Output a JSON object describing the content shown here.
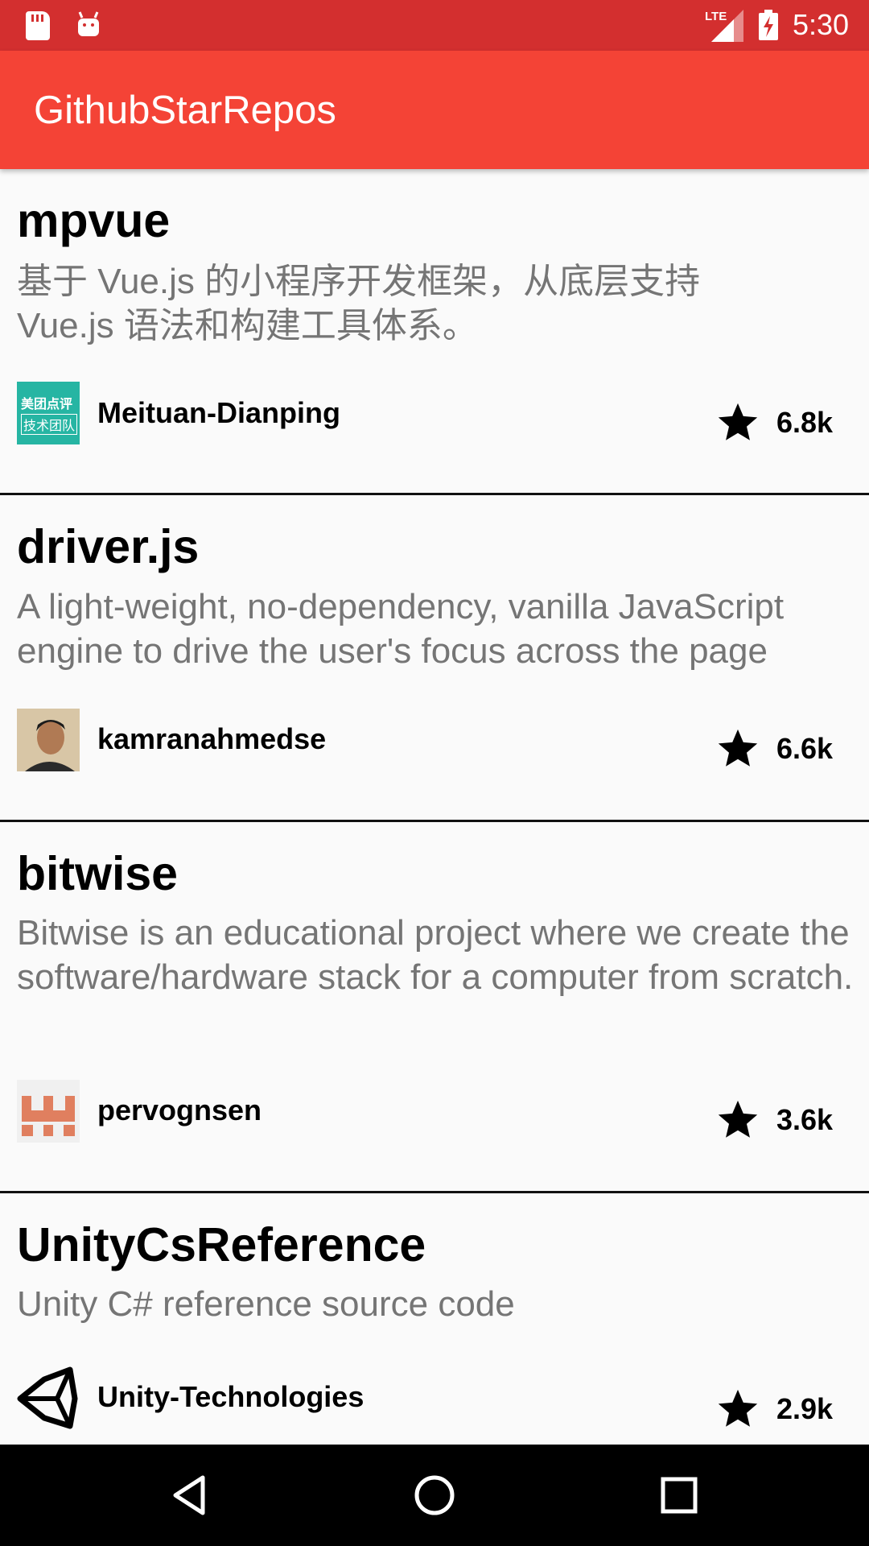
{
  "status_bar": {
    "time": "5:30",
    "network_label": "LTE",
    "icons": [
      "sd-card-icon",
      "android-icon",
      "lte-signal-icon",
      "battery-charging-icon"
    ]
  },
  "app_bar": {
    "title": "GithubStarRepos",
    "color": "#f44336"
  },
  "repos": [
    {
      "name": "mpvue",
      "description": "基于 Vue.js 的小程序开发框架，从底层支持 Vue.js 语法和构建工具体系。",
      "owner": "Meituan-Dianping",
      "stars": "6.8k",
      "avatar_lines": [
        "美团点评",
        "技术团队"
      ]
    },
    {
      "name": "driver.js",
      "description": "A light-weight, no-dependency, vanilla JavaScript engine to drive the user's focus across the page",
      "owner": "kamranahmedse",
      "stars": "6.6k"
    },
    {
      "name": "bitwise",
      "description": "Bitwise is an educational project where we create the software/hardware stack for a computer from scratch.",
      "owner": "pervognsen",
      "stars": "3.6k"
    },
    {
      "name": "UnityCsReference",
      "description": "Unity C# reference source code",
      "owner": "Unity-Technologies",
      "stars": "2.9k"
    }
  ],
  "nav_bar": {
    "buttons": [
      "back-icon",
      "home-icon",
      "recents-icon"
    ]
  }
}
